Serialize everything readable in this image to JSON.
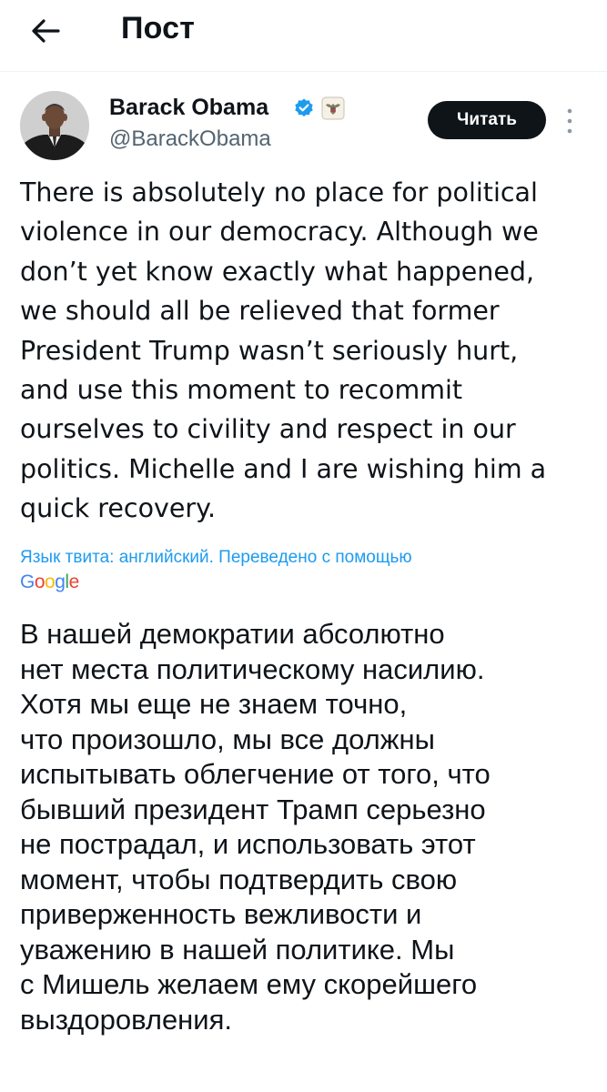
{
  "header": {
    "title": "Пост"
  },
  "author": {
    "name": "Barack Obama",
    "handle": "@BarackObama",
    "verified_color": "#1d9bf0"
  },
  "follow_button": {
    "label": "Читать"
  },
  "tweet": {
    "lines": [
      "There is absolutely no place for political",
      "violence in our democracy. Although we",
      "don’t yet know exactly what happened,",
      "we should all be relieved that former",
      "President Trump wasn’t seriously hurt,",
      "and use this moment to recommit",
      "ourselves to civility and respect in our",
      "politics. Michelle and I are wishing him a",
      "quick recovery."
    ]
  },
  "translation": {
    "note": "Язык твита: английский. Переведено с помощью",
    "provider": "Google",
    "lines": [
      "В нашей демократии абсолютно",
      "нет места политическому насилию.",
      "Хотя мы еще не знаем точно,",
      "что произошло, мы все должны",
      "испытывать облегчение от того, что",
      "бывший президент Трамп серьезно",
      "не пострадал, и использовать этот",
      "момент, чтобы подтвердить свою",
      "приверженность вежливости и",
      "уважению в нашей политике. Мы",
      "с Мишель желаем ему скорейшего",
      "выздоровления."
    ]
  },
  "icons": {
    "back": "arrow-left-icon",
    "verified": "verified-badge-icon",
    "seal": "government-seal-icon",
    "more": "more-vertical-icon"
  },
  "colors": {
    "accent": "#1d9bf0",
    "text": "#0f1419",
    "secondary": "#536471"
  }
}
